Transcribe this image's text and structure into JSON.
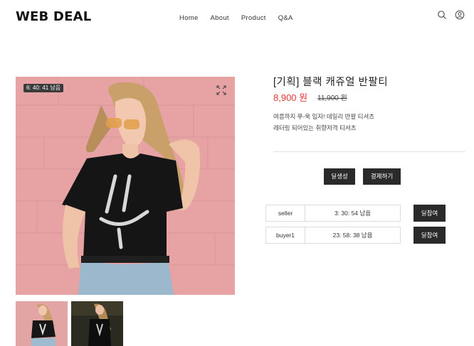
{
  "header": {
    "logo": "WEB DEAL",
    "nav": [
      "Home",
      "About",
      "Product",
      "Q&A"
    ]
  },
  "product": {
    "timer": "6: 40: 41 남음",
    "title": "[기획] 블랙 캐쥬얼 반팔티",
    "price": "8,900 원",
    "original_price": "11,900 원",
    "description": [
      "여름까지 쭈-욱 입자! 데일리 반팔 티셔츠",
      "레터링 되어있는 취향저격 티셔츠"
    ]
  },
  "actions": {
    "create_label": "딜생성",
    "pay_label": "결제하기"
  },
  "deals": [
    {
      "user": "seller",
      "time_left": "3: 30: 54 남음",
      "join_label": "딜참여"
    },
    {
      "user": "buyer1",
      "time_left": "23: 58: 38 남음",
      "join_label": "딜참여"
    }
  ],
  "colors": {
    "price": "#e0383a",
    "button": "#2a2a2a",
    "photo_background": "#e8a6a6"
  }
}
